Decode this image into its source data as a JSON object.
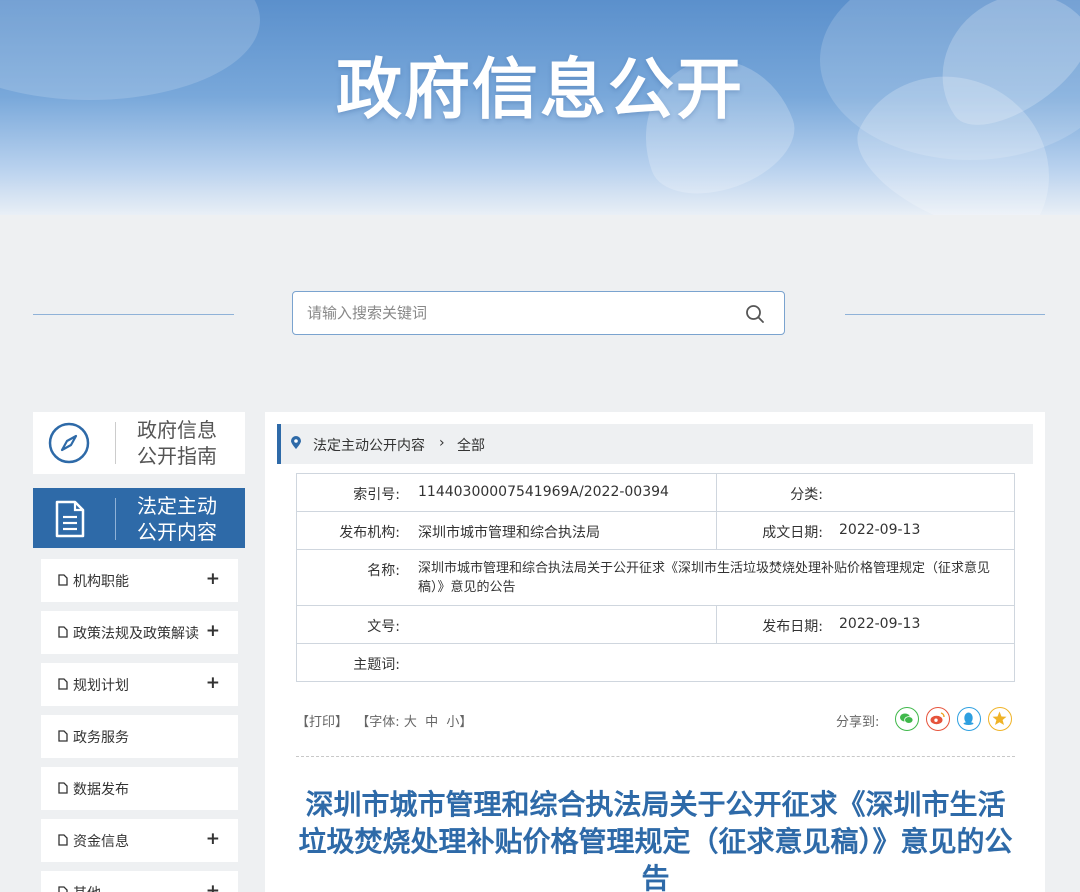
{
  "banner": {
    "title": "政府信息公开"
  },
  "search": {
    "placeholder": "请输入搜索关键词",
    "button_icon": "search-icon"
  },
  "sidebar": {
    "guide": {
      "label_line1": "政府信息",
      "label_line2": "公开指南",
      "icon": "compass-icon"
    },
    "active": {
      "label_line1": "法定主动",
      "label_line2": "公开内容",
      "icon": "document-icon"
    },
    "items": [
      {
        "label": "机构职能",
        "expand": "+"
      },
      {
        "label": "政策法规及政策解读",
        "expand": "+"
      },
      {
        "label": "规划计划",
        "expand": "+"
      },
      {
        "label": "政务服务",
        "expand": ""
      },
      {
        "label": "数据发布",
        "expand": ""
      },
      {
        "label": "资金信息",
        "expand": "+"
      },
      {
        "label": "其他",
        "expand": "+"
      }
    ]
  },
  "breadcrumb": {
    "item1": "法定主动公开内容",
    "separator": "›",
    "item2": "全部"
  },
  "info": {
    "index_label": "索引号:",
    "index_value": "11440300007541969A/2022-00394",
    "category_label": "分类:",
    "category_value": "",
    "agency_label": "发布机构:",
    "agency_value": "深圳市城市管理和综合执法局",
    "created_label": "成文日期:",
    "created_value": "2022-09-13",
    "name_label": "名称:",
    "name_value": "深圳市城市管理和综合执法局关于公开征求《深圳市生活垃圾焚烧处理补贴价格管理规定（征求意见稿）》意见的公告",
    "docno_label": "文号:",
    "docno_value": "",
    "published_label": "发布日期:",
    "published_value": "2022-09-13",
    "subject_label": "主题词:",
    "subject_value": ""
  },
  "tools": {
    "print": "【打印】",
    "font_prefix": "【字体:",
    "font_large": "大",
    "font_medium": "中",
    "font_small": "小】"
  },
  "share": {
    "label": "分享到:",
    "icons": [
      "wechat-icon",
      "weibo-icon",
      "qq-icon",
      "qzone-icon"
    ]
  },
  "document": {
    "title": "深圳市城市管理和综合执法局关于公开征求《深圳市生活垃圾焚烧处理补贴价格管理规定（征求意见稿）》意见的公告"
  },
  "colors": {
    "brand": "#2e6aa8",
    "wechat": "#3fb84a",
    "weibo": "#e6533b",
    "qq": "#2d9fe0",
    "qzone": "#f0b326"
  }
}
